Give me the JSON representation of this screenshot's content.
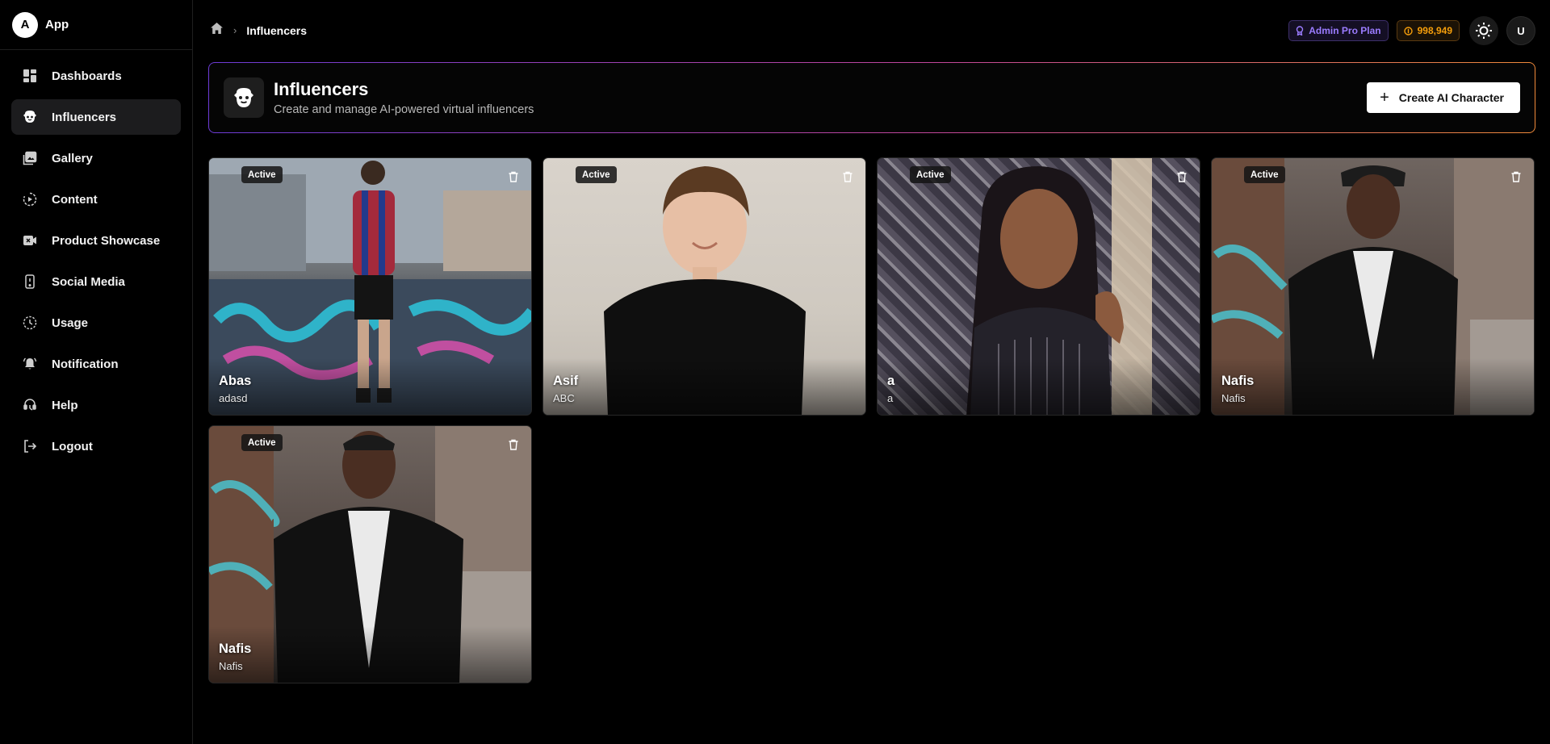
{
  "brand": {
    "avatar_letter": "A",
    "name": "App"
  },
  "sidebar": {
    "items": [
      {
        "label": "Dashboards",
        "icon": "dashboard-icon",
        "active": false
      },
      {
        "label": "Influencers",
        "icon": "robot-face-icon",
        "active": true
      },
      {
        "label": "Gallery",
        "icon": "gallery-icon",
        "active": false
      },
      {
        "label": "Content",
        "icon": "play-circle-icon",
        "active": false
      },
      {
        "label": "Product Showcase",
        "icon": "video-camera-icon",
        "active": false
      },
      {
        "label": "Social Media",
        "icon": "phone-icon",
        "active": false
      },
      {
        "label": "Usage",
        "icon": "dashed-clock-icon",
        "active": false
      },
      {
        "label": "Notification",
        "icon": "bell-ring-icon",
        "active": false
      },
      {
        "label": "Help",
        "icon": "headset-icon",
        "active": false
      },
      {
        "label": "Logout",
        "icon": "logout-icon",
        "active": false
      }
    ]
  },
  "breadcrumb": {
    "current": "Influencers"
  },
  "topbar": {
    "plan_label": "Admin Pro Plan",
    "credits": "998,949",
    "user_initial": "U"
  },
  "header": {
    "title": "Influencers",
    "subtitle": "Create and manage AI-powered virtual influencers",
    "create_button": "Create AI Character"
  },
  "influencers": [
    {
      "name": "Abas",
      "handle": "adasd",
      "status": "Active"
    },
    {
      "name": "Asif",
      "handle": "ABC",
      "status": "Active"
    },
    {
      "name": "a",
      "handle": "a",
      "status": "Active"
    },
    {
      "name": "Nafis",
      "handle": "Nafis",
      "status": "Active"
    },
    {
      "name": "Nafis",
      "handle": "Nafis",
      "status": "Active"
    }
  ],
  "colors": {
    "plan_accent": "#9b7cff",
    "credits_accent": "#f59e0b"
  }
}
